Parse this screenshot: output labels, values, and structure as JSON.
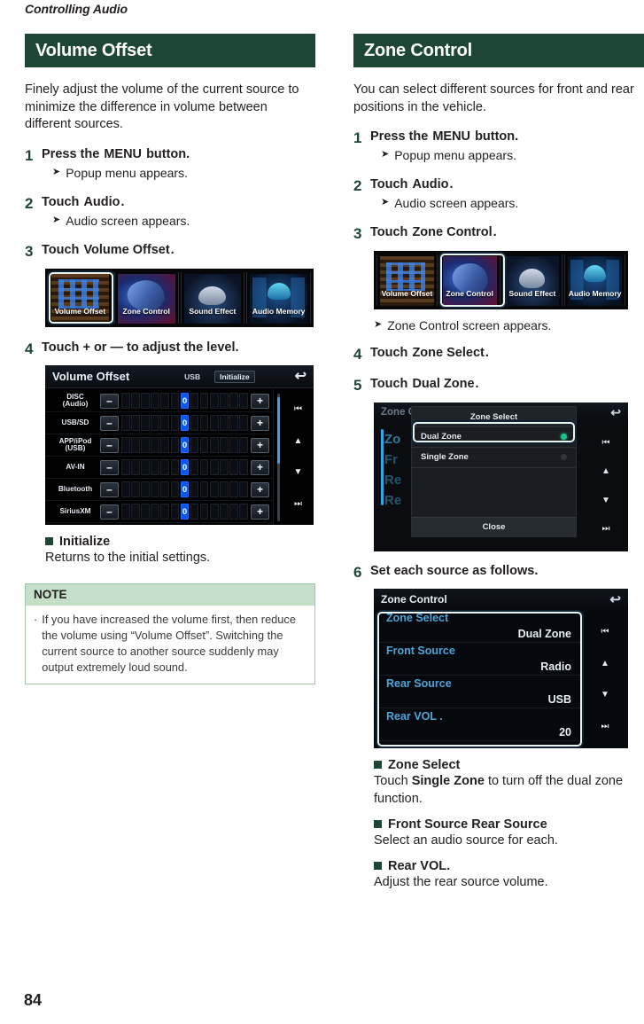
{
  "running_head": "Controlling Audio",
  "page_number": "84",
  "colors": {
    "accent_green": "#1e4634",
    "note_header": "#c6dfc9",
    "note_border": "#9fc6a8"
  },
  "left": {
    "section_title": "Volume Offset",
    "intro": "Finely adjust the volume of the current source to minimize the difference in volume between different sources.",
    "steps": [
      {
        "num": "1",
        "pre": "Press the",
        "kw": "MENU",
        "post": "button.",
        "sub": "Popup menu appears."
      },
      {
        "num": "2",
        "pre": "Touch",
        "kw": "Audio",
        "post": ".",
        "sub": "Audio screen appears."
      },
      {
        "num": "3",
        "pre": "Touch",
        "kw": "Volume Offset",
        "post": ".",
        "sub": ""
      },
      {
        "num": "4",
        "pre": "Touch",
        "kw": "+ or —",
        "post": "to adjust the level.",
        "sub": ""
      }
    ],
    "menu_strip": {
      "tiles": [
        {
          "label": "Volume Offset",
          "art": "art-vol",
          "highlighted": true
        },
        {
          "label": "Zone Control",
          "art": "art-zone",
          "highlighted": false
        },
        {
          "label": "Sound Effect",
          "art": "art-sound",
          "highlighted": false
        },
        {
          "label": "Audio Memory",
          "art": "art-mem",
          "highlighted": false
        }
      ]
    },
    "volume_offset_screen": {
      "title": "Volume Offset",
      "source": "USB",
      "initialize_label": "Initialize",
      "back_icon": "back-arrow-icon",
      "minus_label": "—",
      "plus_label": "+",
      "rows": [
        {
          "label": "DISC\n(Audio)",
          "value": "0"
        },
        {
          "label": "USB/SD",
          "value": "0"
        },
        {
          "label": "APP/iPod\n(USB)",
          "value": "0"
        },
        {
          "label": "AV-IN",
          "value": "0"
        },
        {
          "label": "Bluetooth",
          "value": "0"
        },
        {
          "label": "SiriusXM",
          "value": "0"
        }
      ],
      "side_icons": [
        "top-icon",
        "up-icon",
        "down-icon",
        "bottom-icon"
      ]
    },
    "bullets": [
      {
        "head": "Initialize",
        "desc": "Returns to the initial settings."
      }
    ],
    "note": {
      "title": "NOTE",
      "body": "If you have increased the volume first, then reduce the volume using “Volume Offset”. Switching the current source to another source suddenly may output extremely loud sound."
    }
  },
  "right": {
    "section_title": "Zone Control",
    "intro": "You can select different sources for front and rear positions in the vehicle.",
    "steps": [
      {
        "num": "1",
        "pre": "Press the",
        "kw": "MENU",
        "post": "button.",
        "sub": "Popup menu appears."
      },
      {
        "num": "2",
        "pre": "Touch",
        "kw": "Audio",
        "post": ".",
        "sub": "Audio screen appears."
      },
      {
        "num": "3",
        "pre": "Touch",
        "kw": "Zone Control",
        "post": ".",
        "sub": "Zone Control screen appears."
      },
      {
        "num": "4",
        "pre": "Touch",
        "kw": "Zone Select",
        "post": ".",
        "sub": ""
      },
      {
        "num": "5",
        "pre": "Touch",
        "kw": "Dual Zone",
        "post": ".",
        "sub": ""
      },
      {
        "num": "6",
        "pre": "Set each source as follows.",
        "kw": "",
        "post": "",
        "sub": ""
      }
    ],
    "menu_strip": {
      "tiles": [
        {
          "label": "Volume Offset",
          "art": "art-vol",
          "highlighted": false
        },
        {
          "label": "Zone Control",
          "art": "art-zone",
          "highlighted": true
        },
        {
          "label": "Sound Effect",
          "art": "art-sound",
          "highlighted": false
        },
        {
          "label": "Audio Memory",
          "art": "art-mem",
          "highlighted": false
        }
      ]
    },
    "zone_select_dialog": {
      "screen_title": "Zone Control",
      "back_icon": "back-arrow-icon",
      "dialog_title": "Zone Select",
      "options": [
        {
          "label": "Dual Zone",
          "selected": true
        },
        {
          "label": "Single Zone",
          "selected": false
        }
      ],
      "close_label": "Close",
      "ghost_rows": [
        "Zo",
        "Fr",
        "Re",
        "Re"
      ],
      "side_icons": [
        "top-icon",
        "up-icon",
        "down-icon",
        "bottom-icon"
      ]
    },
    "zone_control_screen": {
      "title": "Zone Control",
      "back_icon": "back-arrow-icon",
      "rows": [
        {
          "key": "Zone Select",
          "value": "Dual Zone"
        },
        {
          "key": "Front Source",
          "value": "Radio"
        },
        {
          "key": "Rear Source",
          "value": "USB"
        },
        {
          "key": "Rear VOL .",
          "value": "20"
        }
      ],
      "side_icons": [
        "top-icon",
        "up-icon",
        "down-icon",
        "bottom-icon"
      ]
    },
    "bullets": [
      {
        "head": "Zone Select",
        "desc_pre": "Touch",
        "desc_kw": "Single Zone",
        "desc_post": "to turn off the dual zone function."
      },
      {
        "head": "Front Source  Rear Source",
        "desc_pre": "Select an audio source for each.",
        "desc_kw": "",
        "desc_post": ""
      },
      {
        "head": "Rear VOL.",
        "desc_pre": "Adjust the rear source volume.",
        "desc_kw": "",
        "desc_post": ""
      }
    ]
  }
}
